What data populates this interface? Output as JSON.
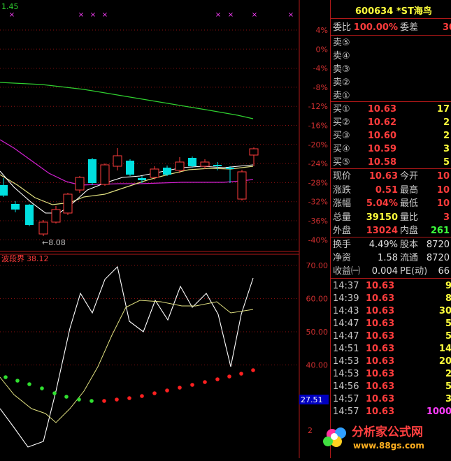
{
  "top_indicator_value": "1.45",
  "main_axis_labels": [
    "4%",
    "0%",
    "-4%",
    "-8%",
    "-12%",
    "-16%",
    "-20%",
    "-24%",
    "-28%",
    "-32%",
    "-36%",
    "-40%"
  ],
  "low_price_note": "←8.08",
  "sub_indicator": {
    "name": "波段界",
    "value": "38.12"
  },
  "sub_axis_labels": [
    "70.00",
    "60.00",
    "50.00",
    "40.00"
  ],
  "sub_axis_partial": "2",
  "cursor_value": "27.51",
  "stock": {
    "code": "600634",
    "name": "*ST海鸟"
  },
  "weibi": {
    "label1": "委比",
    "value1": "100.00%",
    "label2": "委差",
    "value2": "30"
  },
  "sell": [
    {
      "label": "卖⑤"
    },
    {
      "label": "卖④"
    },
    {
      "label": "卖③"
    },
    {
      "label": "卖②"
    },
    {
      "label": "卖①"
    }
  ],
  "buy": [
    {
      "label": "买①",
      "price": "10.63",
      "vol": "17"
    },
    {
      "label": "买②",
      "price": "10.62",
      "vol": "2"
    },
    {
      "label": "买③",
      "price": "10.60",
      "vol": "2"
    },
    {
      "label": "买④",
      "price": "10.59",
      "vol": "3"
    },
    {
      "label": "买⑤",
      "price": "10.58",
      "vol": "5"
    }
  ],
  "quote": [
    {
      "l1": "现价",
      "v1": "10.63",
      "c1": "red",
      "l2": "今开",
      "v2": "10",
      "c2": "red"
    },
    {
      "l1": "涨跌",
      "v1": "0.51",
      "c1": "red",
      "l2": "最高",
      "v2": "10",
      "c2": "red"
    },
    {
      "l1": "涨幅",
      "v1": "5.04%",
      "c1": "red",
      "l2": "最低",
      "v2": "10",
      "c2": "red"
    },
    {
      "l1": "总量",
      "v1": "39150",
      "c1": "yel",
      "l2": "量比",
      "v2": "3",
      "c2": "red"
    },
    {
      "l1": "外盘",
      "v1": "13024",
      "c1": "red",
      "l2": "内盘",
      "v2": "261",
      "c2": "grn"
    }
  ],
  "fin": [
    {
      "l1": "换手",
      "v1": "4.49%",
      "l2": "股本",
      "v2": "8720"
    },
    {
      "l1": "净资",
      "v1": "1.58",
      "l2": "流通",
      "v2": "8720"
    },
    {
      "l1": "收益㈠",
      "v1": "0.004",
      "l2": "PE(动)",
      "v2": "66"
    }
  ],
  "ticks": [
    {
      "time": "14:37",
      "price": "10.63",
      "vol": "9",
      "vc": "yel"
    },
    {
      "time": "14:39",
      "price": "10.63",
      "vol": "8",
      "vc": "yel"
    },
    {
      "time": "14:43",
      "price": "10.63",
      "vol": "30",
      "vc": "yel"
    },
    {
      "time": "14:47",
      "price": "10.63",
      "vol": "5",
      "vc": "yel"
    },
    {
      "time": "14:47",
      "price": "10.63",
      "vol": "5",
      "vc": "yel"
    },
    {
      "time": "14:51",
      "price": "10.63",
      "vol": "14",
      "vc": "yel"
    },
    {
      "time": "14:53",
      "price": "10.63",
      "vol": "20",
      "vc": "yel"
    },
    {
      "time": "14:53",
      "price": "10.63",
      "vol": "2",
      "vc": "yel"
    },
    {
      "time": "14:56",
      "price": "10.63",
      "vol": "5",
      "vc": "yel"
    },
    {
      "time": "14:57",
      "price": "10.63",
      "vol": "3",
      "vc": "yel"
    },
    {
      "time": "14:57",
      "price": "10.63",
      "vol": "1000",
      "vc": "mag"
    }
  ],
  "logo": {
    "text": "分析家公式网",
    "url": "www.88gs.com"
  },
  "colors": {
    "up": "#ff3c3c",
    "down": "#00e0e0",
    "ma_green": "#30d030",
    "ma_mag": "#d020d0",
    "ma_yel": "#e0e080",
    "grid": "#8b1010"
  }
}
